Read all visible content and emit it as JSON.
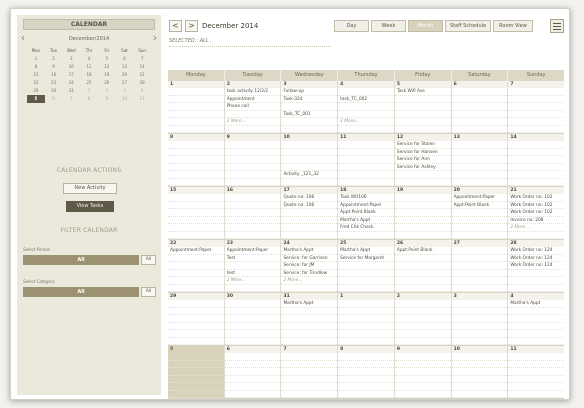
{
  "sidebar": {
    "calendar_tab": "CALENDAR",
    "mini": {
      "month_label": "December/2014",
      "weekdays": [
        "Mon",
        "Tue",
        "Wed",
        "Thr",
        "Fri",
        "Sat",
        "Sun"
      ],
      "rows": [
        [
          "1",
          "2",
          "3",
          "4",
          "5",
          "6",
          "7"
        ],
        [
          "8",
          "9",
          "10",
          "11",
          "12",
          "13",
          "14"
        ],
        [
          "15",
          "16",
          "17",
          "18",
          "19",
          "20",
          "21"
        ],
        [
          "22",
          "23",
          "24",
          "25",
          "26",
          "27",
          "28"
        ],
        [
          "29",
          "30",
          "31",
          "1",
          "2",
          "3",
          "4"
        ],
        [
          "5",
          "6",
          "7",
          "8",
          "9",
          "10",
          "11"
        ]
      ]
    },
    "calendar_actions_heading": "CALENDAR ACTIONS",
    "new_activity_label": "New Activity",
    "view_tasks_label": "View Tasks",
    "filter_heading": "FILTER CALENDAR",
    "select_person_label": "Select Person",
    "select_person_value": "All",
    "select_person_all_btn": "All",
    "select_category_label": "Select Category",
    "select_category_value": "All",
    "select_category_all_btn": "All"
  },
  "toolbar": {
    "prev": "<",
    "next": ">",
    "month_title": "December 2014",
    "views": [
      "Day",
      "Week",
      "Month",
      "Staff Schedule",
      "Room View"
    ],
    "active_view": "Month",
    "selected_label": "SELECTED : ALL ,"
  },
  "calendar": {
    "weekdays": [
      "Monday",
      "Tuesday",
      "Wednesday",
      "Thursday",
      "Friday",
      "Saturday",
      "Sunday"
    ],
    "weeks": [
      [
        {
          "day": "1",
          "events": []
        },
        {
          "day": "2",
          "events": [
            "task activity 12/2/2",
            "Appointment",
            "Phone call",
            "",
            "2 More..."
          ]
        },
        {
          "day": "3",
          "events": [
            "Follow-up",
            "Task-324",
            "",
            "Task_TC_001",
            ""
          ]
        },
        {
          "day": "4",
          "events": [
            "",
            "task_TC_002",
            "",
            "",
            "2 More..."
          ]
        },
        {
          "day": "5",
          "events": [
            "Task Wifi Ave"
          ]
        },
        {
          "day": "6",
          "events": []
        },
        {
          "day": "7",
          "events": []
        }
      ],
      [
        {
          "day": "8",
          "events": []
        },
        {
          "day": "9",
          "events": []
        },
        {
          "day": "10",
          "events": [
            "",
            "",
            "",
            "",
            "Activity _121_32"
          ]
        },
        {
          "day": "11",
          "events": []
        },
        {
          "day": "12",
          "events": [
            "Service for Stolen",
            "Service for Hansen",
            "Service for Ann",
            "Service for Ashley"
          ]
        },
        {
          "day": "13",
          "events": []
        },
        {
          "day": "14",
          "events": []
        }
      ],
      [
        {
          "day": "15",
          "events": []
        },
        {
          "day": "16",
          "events": []
        },
        {
          "day": "17",
          "events": [
            "Quote no: 106",
            "Quote no: 106"
          ]
        },
        {
          "day": "18",
          "events": [
            "Task WO106",
            "Appointment:Paper",
            "Appt:Point Blank",
            "Martha's Appt",
            "Fred Chk Check"
          ]
        },
        {
          "day": "19",
          "events": []
        },
        {
          "day": "20",
          "events": [
            "Appointment:Paper",
            "Appt:Point Blank"
          ]
        },
        {
          "day": "21",
          "events": [
            "Work Order no: 102",
            "Work Order no: 102",
            "Work Order no: 102",
            "Invoice no: 208",
            "2 More..."
          ]
        }
      ],
      [
        {
          "day": "22",
          "events": [
            "Appointment:Paper"
          ]
        },
        {
          "day": "23",
          "events": [
            "Appointment:Paper",
            "Test",
            "",
            "test",
            "2 More..."
          ]
        },
        {
          "day": "24",
          "events": [
            "Martha's Appt",
            "Service: for Garrison",
            "Service: for JM",
            "Service: for Trindlow",
            "2 More..."
          ]
        },
        {
          "day": "25",
          "events": [
            "Martha's Appt",
            "Service for Margaret"
          ]
        },
        {
          "day": "26",
          "events": [
            "Appt:Point Blank"
          ]
        },
        {
          "day": "27",
          "events": []
        },
        {
          "day": "28",
          "events": [
            "Work Order no: 124",
            "Work Order no: 124",
            "Work Order no: 124"
          ]
        }
      ],
      [
        {
          "day": "29",
          "events": []
        },
        {
          "day": "30",
          "events": []
        },
        {
          "day": "31",
          "events": [
            "Martha's Appt"
          ]
        },
        {
          "day": "1",
          "events": []
        },
        {
          "day": "2",
          "events": []
        },
        {
          "day": "3",
          "events": []
        },
        {
          "day": "4",
          "events": [
            "Martha's Appt"
          ]
        }
      ],
      [
        {
          "day": "5",
          "events": []
        },
        {
          "day": "6",
          "events": []
        },
        {
          "day": "7",
          "events": []
        },
        {
          "day": "8",
          "events": []
        },
        {
          "day": "9",
          "events": []
        },
        {
          "day": "10",
          "events": []
        },
        {
          "day": "11",
          "events": []
        }
      ]
    ]
  },
  "colors": {
    "accent": "#5f5a48",
    "sidebar_bg": "#ebe8dc",
    "header_bg": "#ddd8c5",
    "filter_bar": "#9c9170"
  }
}
